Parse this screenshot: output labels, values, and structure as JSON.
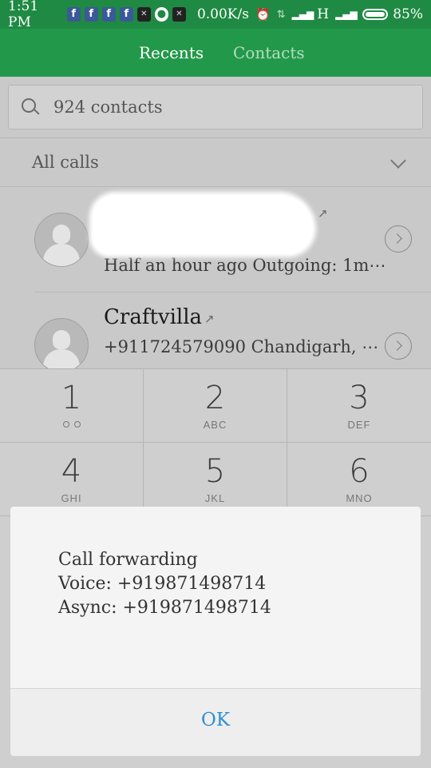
{
  "status_bar": {
    "time": "1:51 PM",
    "network_speed": "0.00K/s",
    "network_type": "H",
    "battery": "85%"
  },
  "tabs": {
    "recents": "Recents",
    "contacts": "Contacts"
  },
  "search": {
    "placeholder": "924 contacts"
  },
  "filter": {
    "label": "All calls"
  },
  "calls": [
    {
      "name": "",
      "detail": "Half an hour ago Outgoing: 1m⋯"
    },
    {
      "name": "Craftvilla",
      "detail": "+911724579090 Chandigarh, ⋯"
    }
  ],
  "keypad": [
    {
      "digit": "1",
      "letters": ""
    },
    {
      "digit": "2",
      "letters": "ABC"
    },
    {
      "digit": "3",
      "letters": "DEF"
    },
    {
      "digit": "4",
      "letters": "GHI"
    },
    {
      "digit": "5",
      "letters": "JKL"
    },
    {
      "digit": "6",
      "letters": "MNO"
    }
  ],
  "dialog": {
    "title": "Call forwarding",
    "voice": "Voice: +919871498714",
    "async": "Async: +919871498714",
    "ok_label": "OK"
  },
  "colors": {
    "header_green": "#22994a",
    "accent_blue": "#2e8fd1"
  }
}
